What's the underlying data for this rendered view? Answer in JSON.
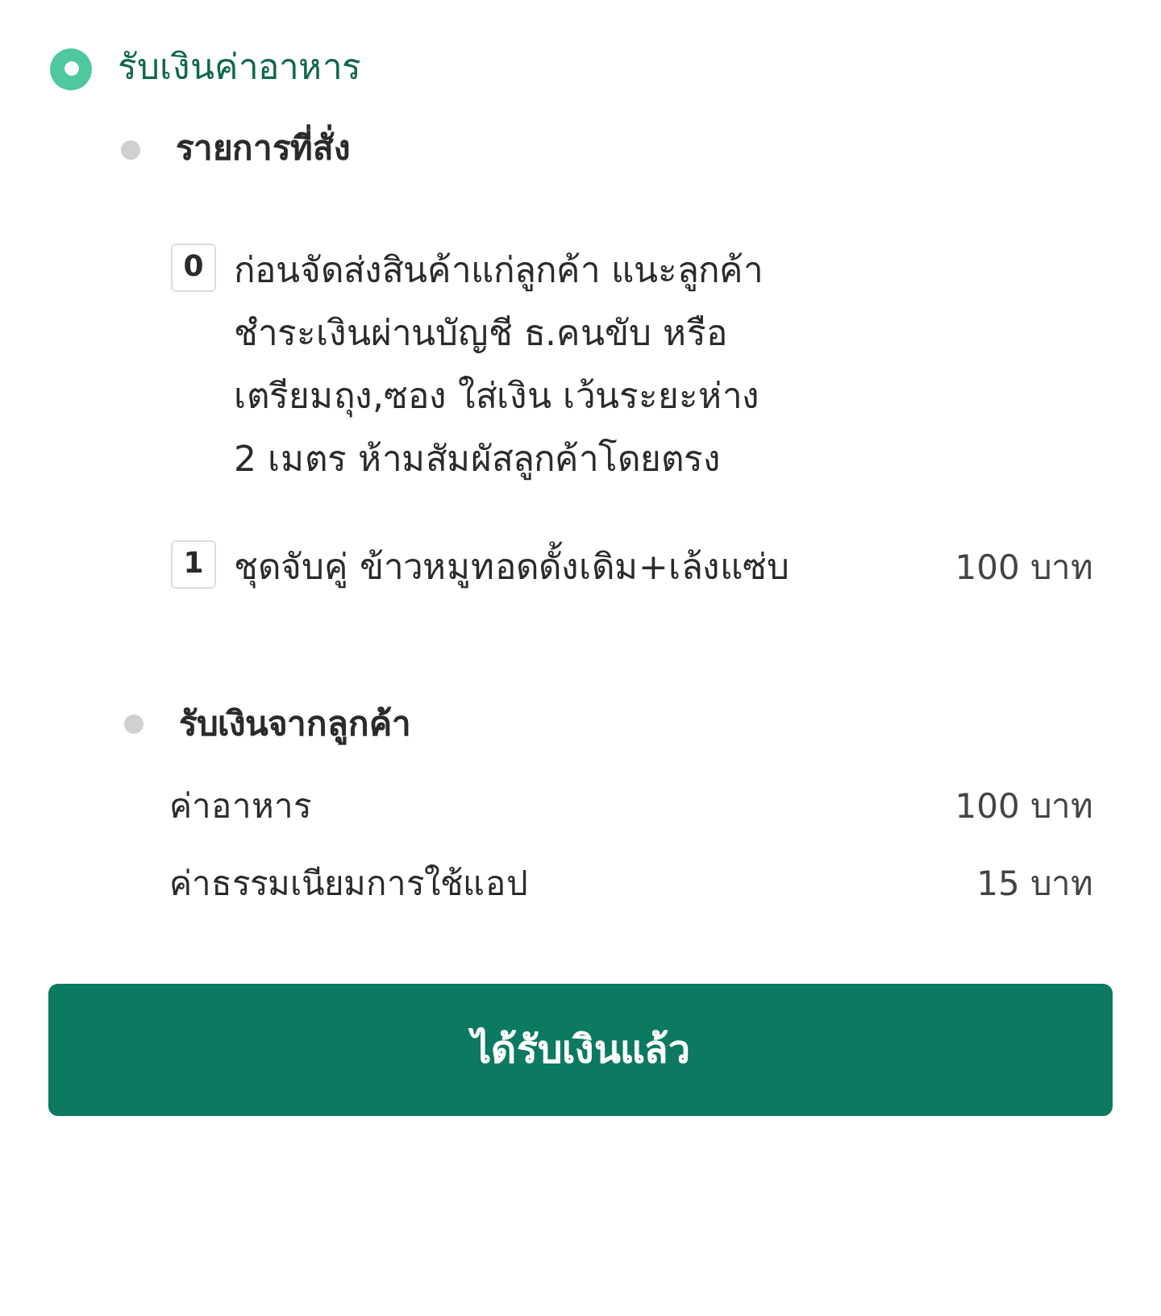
{
  "step": {
    "title": "รับเงินค่าอาหาร"
  },
  "order": {
    "heading": "รายการที่สั่ง",
    "items": [
      {
        "quantity": "0",
        "name": "ก่อนจัดส่งสินค้าแก่ลูกค้า แนะลูกค้าชำระเงินผ่านบัญชี ธ.คนขับ หรือเตรียมถุง,ซอง ใส่เงิน เว้นระยะห่าง 2 เมตร ห้ามสัมผัสลูกค้าโดยตรง"
      },
      {
        "quantity": "1",
        "name": "ชุดจับคู่ ข้าวหมูทอดดั้งเดิม+เล้งแซ่บ",
        "price": "100 บาท"
      }
    ]
  },
  "payment": {
    "heading": "รับเงินจากลูกค้า",
    "rows": [
      {
        "label": "ค่าอาหาร",
        "amount": "100 บาท"
      },
      {
        "label": "ค่าธรรมเนียมการใช้แอป",
        "amount": "15 บาท"
      }
    ]
  },
  "confirm_button": "ได้รับเงินแล้ว"
}
